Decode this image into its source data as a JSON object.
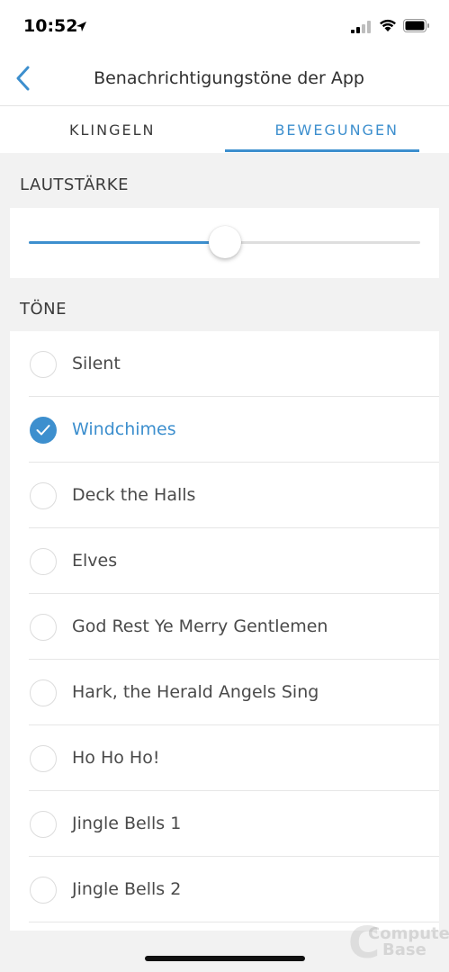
{
  "status_bar": {
    "time": "10:52",
    "icons": [
      "location-arrow-icon",
      "signal-icon",
      "wifi-icon",
      "battery-icon"
    ]
  },
  "nav": {
    "title": "Benachrichtigungstöne der App",
    "back_icon": "chevron-left-icon"
  },
  "tabs": [
    {
      "label": "KLINGELN",
      "active": false
    },
    {
      "label": "BEWEGUNGEN",
      "active": true
    }
  ],
  "volume": {
    "header": "LAUTSTÄRKE",
    "level": 0.5
  },
  "tones": {
    "header": "TÖNE",
    "items": [
      {
        "label": "Silent",
        "selected": false
      },
      {
        "label": "Windchimes",
        "selected": true
      },
      {
        "label": "Deck the Halls",
        "selected": false
      },
      {
        "label": "Elves",
        "selected": false
      },
      {
        "label": "God Rest Ye Merry Gentlemen",
        "selected": false
      },
      {
        "label": "Hark, the Herald Angels Sing",
        "selected": false
      },
      {
        "label": "Ho Ho Ho!",
        "selected": false
      },
      {
        "label": "Jingle Bells 1",
        "selected": false
      },
      {
        "label": "Jingle Bells 2",
        "selected": false
      }
    ]
  },
  "watermark": {
    "line1": "Computer",
    "line2": "Base"
  },
  "colors": {
    "accent": "#3d8fce",
    "background": "#f2f2f2",
    "card": "#ffffff",
    "text": "#3a3a3a"
  }
}
